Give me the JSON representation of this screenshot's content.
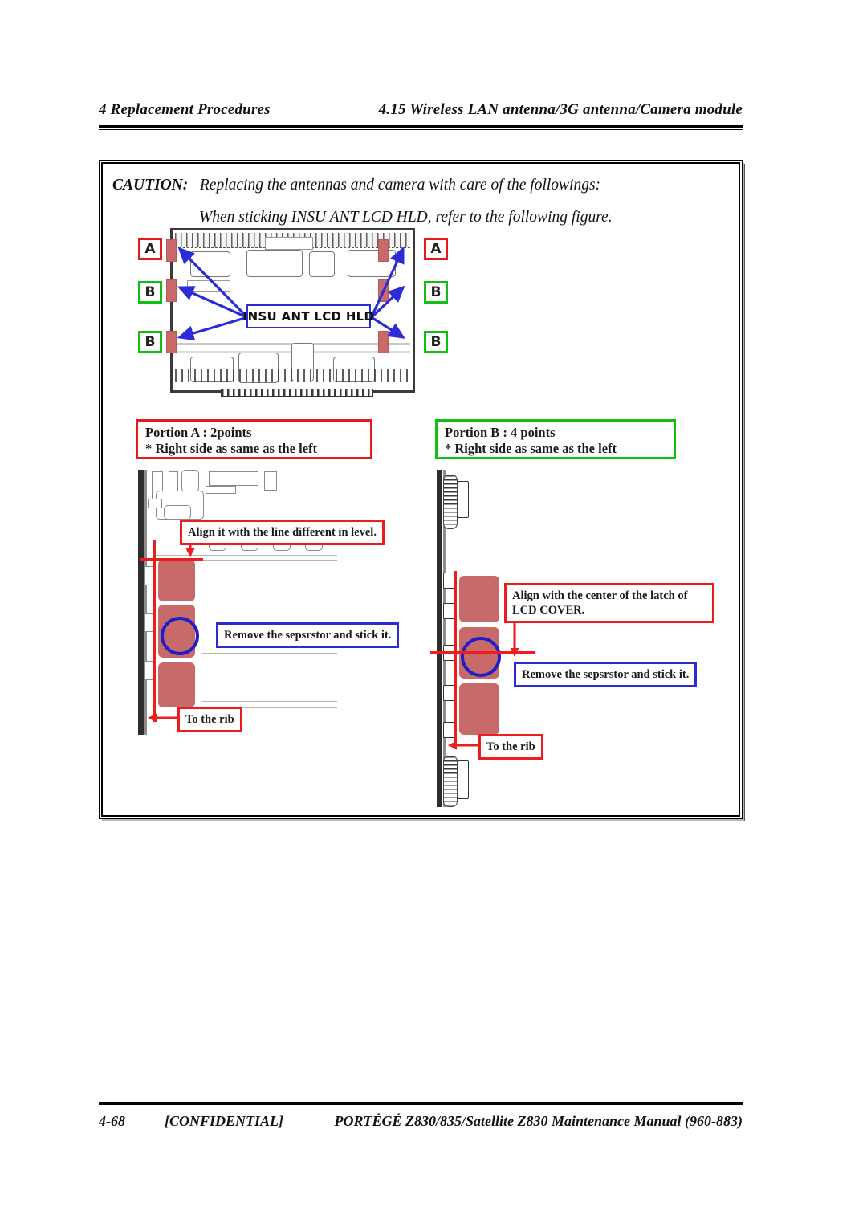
{
  "header": {
    "left": "4 Replacement Procedures",
    "right": "4.15 Wireless LAN antenna/3G antenna/Camera module"
  },
  "caution": {
    "label": "CAUTION:",
    "line1": "Replacing the antennas and camera with care of the followings:",
    "line2": "When sticking INSU ANT LCD HLD, refer to the following figure."
  },
  "figure": {
    "lcd_panel": {
      "callout_label": "INSU ANT  LCD  HLD",
      "tags_left": [
        {
          "letter": "A",
          "color": "#e8191a"
        },
        {
          "letter": "B",
          "color": "#0fbe10"
        },
        {
          "letter": "B",
          "color": "#0fbe10"
        }
      ],
      "tags_right": [
        {
          "letter": "A",
          "color": "#e8191a"
        },
        {
          "letter": "B",
          "color": "#0fbe10"
        },
        {
          "letter": "B",
          "color": "#0fbe10"
        }
      ]
    },
    "portion_a": {
      "line1": "Portion A : 2points",
      "line2": "* Right side as same as the left",
      "border_color": "#e8191a"
    },
    "portion_b": {
      "line1": "Portion B : 4 points",
      "line2": "* Right side as same as the left",
      "border_color": "#0fbe10"
    },
    "detail_left": {
      "callout_align": "Align it with the line different in level.",
      "callout_remove": "Remove the sepsrstor and stick it.",
      "callout_rib": "To the rib"
    },
    "detail_right": {
      "callout_align_line1": "Align with the center of the latch of",
      "callout_align_line2": "LCD COVER.",
      "callout_remove": "Remove the sepsrstor and stick it.",
      "callout_rib": "To the rib"
    }
  },
  "footer": {
    "page_number": "4-68",
    "confidential": "[CONFIDENTIAL]",
    "manual": "PORTÉGÉ Z830/835/Satellite Z830 Maintenance Manual (960-883)"
  }
}
